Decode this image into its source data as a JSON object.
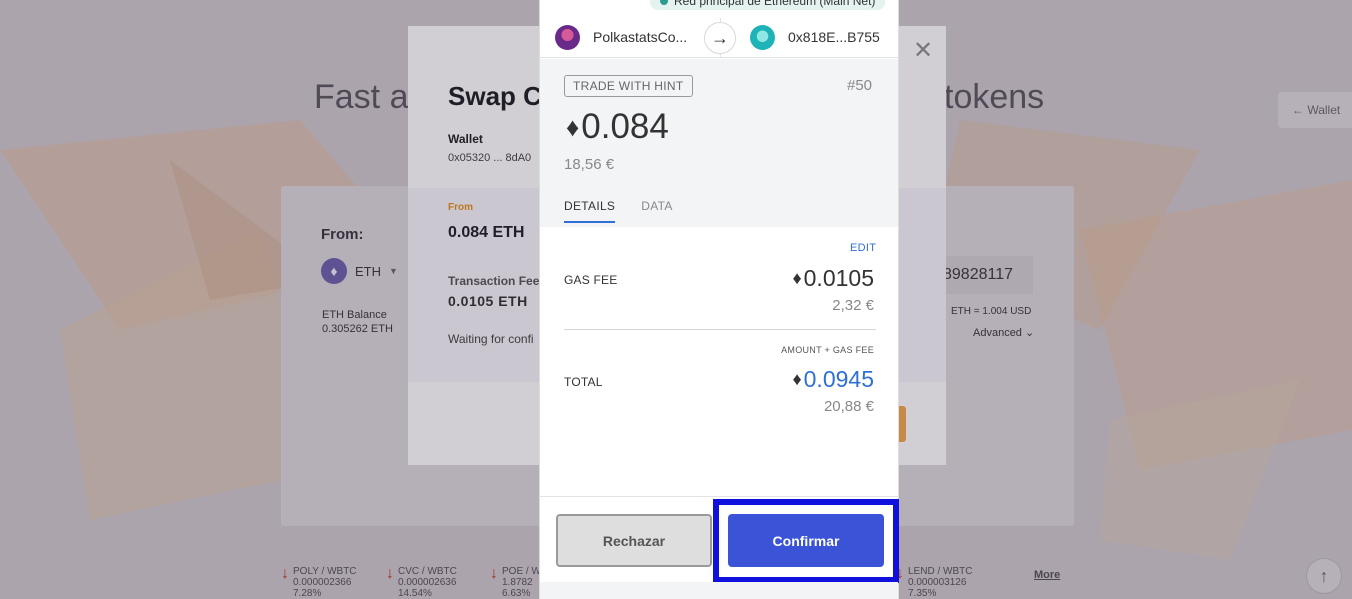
{
  "background": {
    "hero_left": "Fast ar",
    "hero_right": "tokens",
    "wallet_tab": "← Wallet",
    "swap": {
      "from_label": "From:",
      "token": "ETH",
      "balance_label": "ETH Balance",
      "balance_value": "0.305262 ETH",
      "right_address": "89828117",
      "rate": "ETH = 1.004 USD",
      "advanced": "Advanced ⌄"
    },
    "tickers": [
      {
        "pair": "POLY / WBTC",
        "price": "0.000002366",
        "change": "7.28%"
      },
      {
        "pair": "CVC / WBTC",
        "price": "0.000002636",
        "change": "14.54%"
      },
      {
        "pair": "POE / W",
        "price": "1.8782",
        "change": "6.63%"
      },
      {
        "pair": "LEND / WBTC",
        "price": "0.000003126",
        "change": "7.35%"
      }
    ],
    "more": "More"
  },
  "dialog": {
    "title": "Swap Co",
    "wallet_label": "Wallet",
    "wallet_value": "0x05320 ... 8dA0",
    "from_small": "From",
    "from_amount": "0.084 ETH",
    "tx_fee_label": "Transaction Fee",
    "tx_fee_value": "0.0105 ETH",
    "waiting": "Waiting for confi"
  },
  "metamask": {
    "network": "Red principal de Ethereum (Main Net)",
    "from_account": "PolkastatsCo...",
    "to_account": "0x818E...B755",
    "hint_badge": "TRADE WITH HINT",
    "nonce": "#50",
    "amount": "0.084",
    "fiat": "18,56 €",
    "tabs": [
      "DETAILS",
      "DATA"
    ],
    "edit": "EDIT",
    "gas_fee_label": "GAS FEE",
    "gas_fee_value": "0.0105",
    "gas_fee_fiat": "2,32 €",
    "amount_gas_label": "AMOUNT + GAS FEE",
    "total_label": "TOTAL",
    "total_value": "0.0945",
    "total_fiat": "20,88 €",
    "reject_label": "Rechazar",
    "confirm_label": "Confirmar"
  },
  "colors": {
    "confirm": "#3b53d6",
    "highlight": "#1111dd",
    "link": "#2f6fd6"
  }
}
